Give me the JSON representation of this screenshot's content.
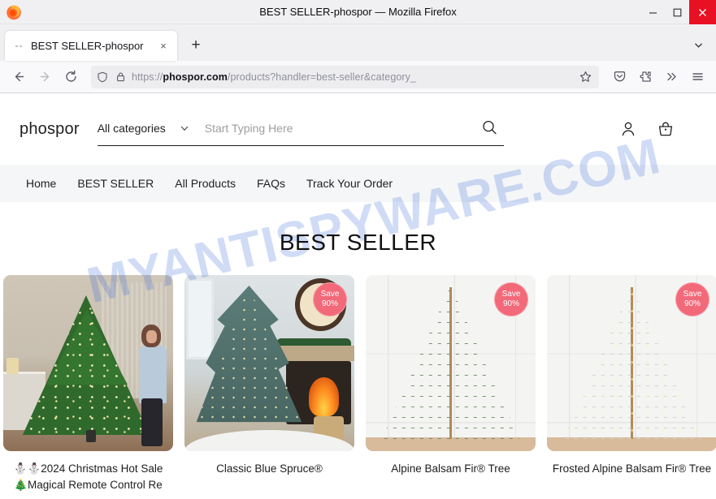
{
  "window": {
    "title": "BEST SELLER-phospor — Mozilla Firefox",
    "minimize_label": "Minimize",
    "maximize_label": "Maximize",
    "close_label": "Close"
  },
  "browser": {
    "tab": {
      "title": "BEST SELLER-phospor",
      "close_label": "×",
      "favicon": "generic-page-icon"
    },
    "new_tab_label": "+",
    "list_all_tabs_label": "⌄",
    "back_label": "←",
    "forward_label": "→",
    "reload_label": "⟳",
    "url": {
      "scheme": "https://",
      "host": "phospor.com",
      "path": "/products?handler=best-seller&category_",
      "full": "https://phospor.com/products?handler=best-seller&category_",
      "shield_icon": "tracking-protection-shield-icon",
      "lock_icon": "padlock-icon",
      "bookmark_icon": "star-icon"
    },
    "toolbar_icons": [
      {
        "name": "pocket-save-icon",
        "glyph": "pocket"
      },
      {
        "name": "extensions-icon",
        "glyph": "extension"
      },
      {
        "name": "overflow-chevrons-icon",
        "glyph": "»"
      },
      {
        "name": "application-menu-icon",
        "glyph": "≡"
      }
    ]
  },
  "site": {
    "brand": "phospor",
    "search": {
      "category_label": "All categories",
      "category_chevron": "chevron-down-icon",
      "placeholder": "Start Typing Here",
      "value": "",
      "search_icon": "search-icon"
    },
    "account_icon": "user-account-icon",
    "cart_icon": "shopping-basket-icon",
    "nav": [
      {
        "label": "Home"
      },
      {
        "label": "BEST SELLER"
      },
      {
        "label": "All Products"
      },
      {
        "label": "FAQs"
      },
      {
        "label": "Track Your Order"
      }
    ],
    "page_title": "BEST SELLER",
    "watermark": "MYANTISPYWARE.COM",
    "badge": {
      "line1": "Save",
      "line2": "90%",
      "color": "#f2697a"
    },
    "products": [
      {
        "title": "⛄⛄2024 Christmas Hot Sale 🎄Magical Remote Control Re",
        "badge": false,
        "image": "lit-green-christmas-tree-with-woman"
      },
      {
        "title": "Classic Blue Spruce®",
        "badge": true,
        "image": "blue-spruce-tree-by-fireplace"
      },
      {
        "title": "Alpine Balsam Fir® Tree",
        "badge": true,
        "image": "alpine-balsam-fir-tree"
      },
      {
        "title": "Frosted Alpine Balsam Fir® Tree",
        "badge": true,
        "image": "frosted-alpine-balsam-fir-tree"
      }
    ]
  }
}
